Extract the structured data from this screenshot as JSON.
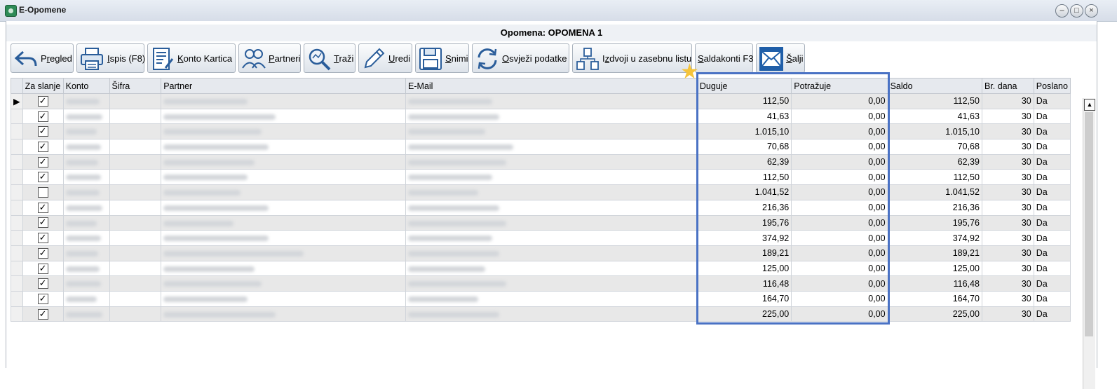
{
  "window": {
    "title": "E-Opomene",
    "controls": [
      "–",
      "□",
      "×"
    ]
  },
  "document_title": "Opomena: OPOMENA 1",
  "toolbar": {
    "pregled": {
      "pre": "P",
      "u": "r",
      "post": "egled"
    },
    "ispis": {
      "pre": "",
      "u": "I",
      "post": "spis (F8)"
    },
    "konto_kartica": {
      "pre": "",
      "u": "K",
      "post": "onto Kartica"
    },
    "partneri": {
      "pre": "",
      "u": "P",
      "post": "artneri"
    },
    "trazi": {
      "pre": "",
      "u": "T",
      "post": "raži"
    },
    "uredi": {
      "pre": "",
      "u": "U",
      "post": "redi"
    },
    "snimi": {
      "pre": "",
      "u": "S",
      "post": "nimi"
    },
    "osvjezi": {
      "pre": "",
      "u": "O",
      "post": "svježi podatke"
    },
    "izdvoji": {
      "pre": "I",
      "u": "z",
      "post": "dvoji u zasebnu listu"
    },
    "saldakonti": {
      "pre": "",
      "u": "S",
      "post": "aldakonti F3"
    },
    "salji": {
      "pre": "",
      "u": "Š",
      "post": "alji"
    }
  },
  "table": {
    "headers": {
      "za_slanje": "Za slanje",
      "konto": "Konto",
      "sifra": "Šifra",
      "partner": "Partner",
      "email": "E-Mail",
      "duguje": "Duguje",
      "potrazuje": "Potražuje",
      "saldo": "Saldo",
      "br_dana": "Br. dana",
      "poslano": "Poslano"
    },
    "rows": [
      {
        "checked": true,
        "duguje": "112,50",
        "potrazuje": "0,00",
        "saldo": "112,50",
        "br_dana": "30",
        "poslano": "Da"
      },
      {
        "checked": true,
        "duguje": "41,63",
        "potrazuje": "0,00",
        "saldo": "41,63",
        "br_dana": "30",
        "poslano": "Da"
      },
      {
        "checked": true,
        "duguje": "1.015,10",
        "potrazuje": "0,00",
        "saldo": "1.015,10",
        "br_dana": "30",
        "poslano": "Da"
      },
      {
        "checked": true,
        "duguje": "70,68",
        "potrazuje": "0,00",
        "saldo": "70,68",
        "br_dana": "30",
        "poslano": "Da"
      },
      {
        "checked": true,
        "duguje": "62,39",
        "potrazuje": "0,00",
        "saldo": "62,39",
        "br_dana": "30",
        "poslano": "Da"
      },
      {
        "checked": true,
        "duguje": "112,50",
        "potrazuje": "0,00",
        "saldo": "112,50",
        "br_dana": "30",
        "poslano": "Da"
      },
      {
        "checked": false,
        "duguje": "1.041,52",
        "potrazuje": "0,00",
        "saldo": "1.041,52",
        "br_dana": "30",
        "poslano": "Da"
      },
      {
        "checked": true,
        "duguje": "216,36",
        "potrazuje": "0,00",
        "saldo": "216,36",
        "br_dana": "30",
        "poslano": "Da"
      },
      {
        "checked": true,
        "duguje": "195,76",
        "potrazuje": "0,00",
        "saldo": "195,76",
        "br_dana": "30",
        "poslano": "Da"
      },
      {
        "checked": true,
        "duguje": "374,92",
        "potrazuje": "0,00",
        "saldo": "374,92",
        "br_dana": "30",
        "poslano": "Da"
      },
      {
        "checked": true,
        "duguje": "189,21",
        "potrazuje": "0,00",
        "saldo": "189,21",
        "br_dana": "30",
        "poslano": "Da"
      },
      {
        "checked": true,
        "duguje": "125,00",
        "potrazuje": "0,00",
        "saldo": "125,00",
        "br_dana": "30",
        "poslano": "Da"
      },
      {
        "checked": true,
        "duguje": "116,48",
        "potrazuje": "0,00",
        "saldo": "116,48",
        "br_dana": "30",
        "poslano": "Da"
      },
      {
        "checked": true,
        "duguje": "164,70",
        "potrazuje": "0,00",
        "saldo": "164,70",
        "br_dana": "30",
        "poslano": "Da"
      },
      {
        "checked": true,
        "duguje": "225,00",
        "potrazuje": "0,00",
        "saldo": "225,00",
        "br_dana": "30",
        "poslano": "Da"
      }
    ]
  },
  "colors": {
    "highlight_border": "#4a72c4",
    "star": "#f5c43b",
    "odd_row": "#e8e8e8"
  }
}
